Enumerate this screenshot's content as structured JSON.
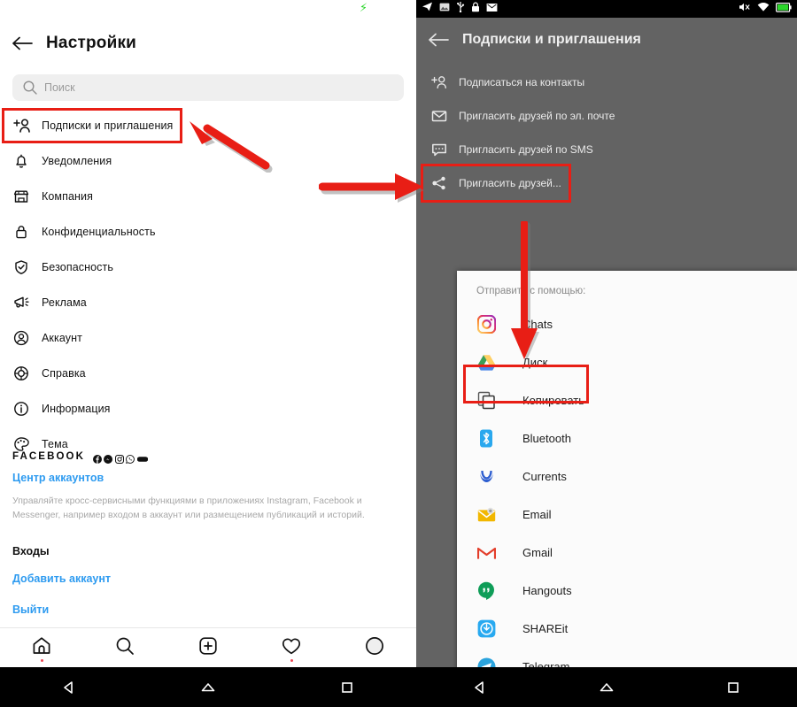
{
  "left_phone": {
    "status_bar": {
      "charging_icon": "bolt-icon"
    },
    "header": {
      "back_icon": "back-arrow-icon",
      "title": "Настройки"
    },
    "search": {
      "icon": "search-icon",
      "placeholder": "Поиск",
      "value": ""
    },
    "settings_items": [
      {
        "icon": "add-person-icon",
        "label": "Подписки и приглашения",
        "highlighted": true
      },
      {
        "icon": "bell-icon",
        "label": "Уведомления"
      },
      {
        "icon": "store-icon",
        "label": "Компания"
      },
      {
        "icon": "lock-icon",
        "label": "Конфиденциальность"
      },
      {
        "icon": "shield-check-icon",
        "label": "Безопасность"
      },
      {
        "icon": "megaphone-icon",
        "label": "Реклама"
      },
      {
        "icon": "account-circle-icon",
        "label": "Аккаунт"
      },
      {
        "icon": "lifebuoy-icon",
        "label": "Справка"
      },
      {
        "icon": "info-icon",
        "label": "Информация"
      },
      {
        "icon": "palette-icon",
        "label": "Тема"
      }
    ],
    "facebook_block": {
      "title": "FACEBOOK",
      "brand_icons": [
        "facebook-icon",
        "messenger-icon",
        "instagram-icon",
        "whatsapp-icon",
        "oculus-icon"
      ],
      "accounts_center_link": "Центр аккаунтов",
      "description": "Управляйте кросс-сервисными функциями в приложениях Instagram, Facebook и Messenger, например входом в аккаунт или размещением публикаций и историй.",
      "logins_heading": "Входы",
      "add_account_link": "Добавить аккаунт",
      "logout_link": "Выйти"
    },
    "bottom_nav": [
      {
        "icon": "home-icon",
        "badge": true
      },
      {
        "icon": "search-icon",
        "badge": false
      },
      {
        "icon": "plus-box-icon",
        "badge": false
      },
      {
        "icon": "heart-icon",
        "badge": true
      },
      {
        "icon": "avatar-icon",
        "badge": false
      }
    ],
    "system_nav": [
      {
        "icon": "back-triangle-icon"
      },
      {
        "icon": "home-pentagon-icon"
      },
      {
        "icon": "recents-square-icon"
      }
    ]
  },
  "right_phone": {
    "status_bar": {
      "left_icons": [
        "telegram-icon",
        "screenshot-icon",
        "usb-icon",
        "lock-icon",
        "mail-icon"
      ],
      "right_icons": [
        "volume-mute-icon",
        "wifi-icon",
        "battery-icon"
      ]
    },
    "header": {
      "back_icon": "back-arrow-icon",
      "title": "Подписки и приглашения"
    },
    "menu_items": [
      {
        "icon": "add-person-icon",
        "label": "Подписаться на контакты"
      },
      {
        "icon": "envelope-icon",
        "label": "Пригласить друзей по эл. почте"
      },
      {
        "icon": "sms-bubble-icon",
        "label": "Пригласить друзей по SMS"
      },
      {
        "icon": "share-icon",
        "label": "Пригласить друзей...",
        "highlighted": true
      }
    ],
    "share_sheet": {
      "title": "Отправить с помощью:",
      "items": [
        {
          "icon": "instagram-icon",
          "label": "Chats"
        },
        {
          "icon": "google-drive-icon",
          "label": "Диск"
        },
        {
          "icon": "copy-icon",
          "label": "Копировать",
          "highlighted": true
        },
        {
          "icon": "bluetooth-icon",
          "label": "Bluetooth"
        },
        {
          "icon": "currents-icon",
          "label": "Currents"
        },
        {
          "icon": "email-icon",
          "label": "Email"
        },
        {
          "icon": "gmail-icon",
          "label": "Gmail"
        },
        {
          "icon": "hangouts-icon",
          "label": "Hangouts"
        },
        {
          "icon": "shareit-icon",
          "label": "SHAREit"
        },
        {
          "icon": "telegram-icon",
          "label": "Telegram"
        }
      ]
    },
    "system_nav": [
      {
        "icon": "back-triangle-icon"
      },
      {
        "icon": "home-pentagon-icon"
      },
      {
        "icon": "recents-square-icon"
      }
    ]
  },
  "annotations": {
    "highlight_color": "#e81e15",
    "arrows": [
      {
        "name": "arrow-to-subscriptions-item",
        "direction": "up-left"
      },
      {
        "name": "arrow-to-invite-friends-item",
        "direction": "right"
      },
      {
        "name": "arrow-to-copy-item",
        "direction": "down"
      }
    ]
  }
}
